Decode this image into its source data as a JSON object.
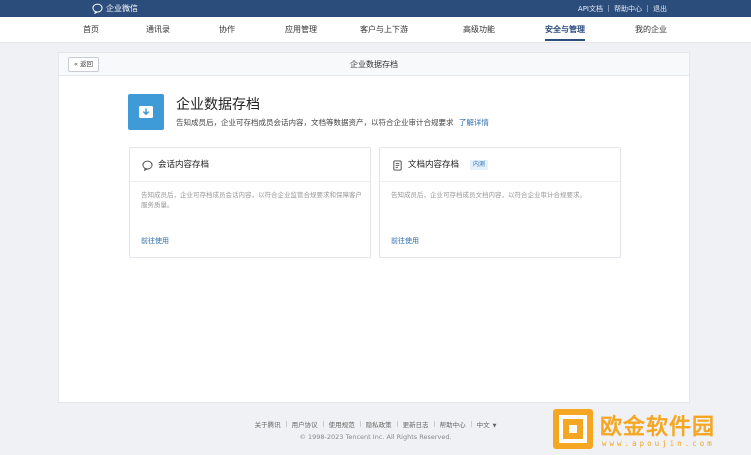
{
  "topbar": {
    "brand": "企业微信",
    "links": [
      "API文档",
      "帮助中心",
      "退出"
    ]
  },
  "nav": {
    "items": [
      "首页",
      "通讯录",
      "协作",
      "应用管理",
      "客户与上下游",
      "高级功能",
      "安全与管理",
      "我的企业"
    ],
    "active": "安全与管理"
  },
  "panel": {
    "back_label": "« 返回",
    "title": "企业数据存档"
  },
  "hero": {
    "icon": "archive-download-icon",
    "title": "企业数据存档",
    "description": "告知成员后，企业可存档成员会话内容，文档等数据资产，以符合企业审计合规要求",
    "link": "了解详情"
  },
  "cards": [
    {
      "icon": "chat-bubble-icon",
      "title": "会话内容存档",
      "badge": "",
      "description": "告知成员后，企业可存档成员会话内容，以符合企业监管合规要求和保障客户服务质量。",
      "action": "前往使用"
    },
    {
      "icon": "document-icon",
      "title": "文档内容存档",
      "badge": "内测",
      "description": "告知成员后，企业可存档成员文档内容，以符合企业审计合规要求。",
      "action": "前往使用"
    }
  ],
  "footer": {
    "links": [
      "关于腾讯",
      "用户协议",
      "使用规范",
      "隐私政策",
      "更新日志",
      "帮助中心",
      "中文"
    ],
    "copyright": "© 1998-2023 Tencent Inc. All Rights Reserved."
  },
  "watermark": {
    "text": "欧金软件园",
    "sub": "www.apoujin.com"
  },
  "colors": {
    "brand": "#2b4d7c",
    "accent": "#3e9bd8",
    "link": "#2b6cb0",
    "watermark": "#f5a623"
  }
}
